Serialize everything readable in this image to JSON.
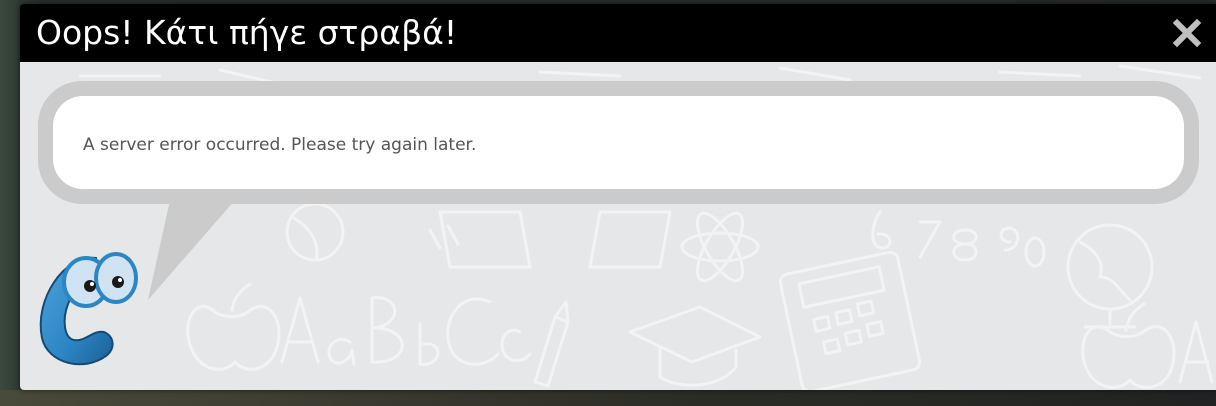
{
  "dialog": {
    "title": "Oops! Κάτι πήγε στραβά!",
    "close_icon": "close-icon",
    "message": "A server error occurred. Please try again later.",
    "mascot_icon": "mascot-icon"
  },
  "colors": {
    "header_bg": "#000000",
    "title_text": "#ffffff",
    "close_icon": "#bfbfbf",
    "body_bg": "#e6e7e8",
    "bubble_border": "#cbcbcb",
    "bubble_bg": "#ffffff",
    "message_text": "#555555",
    "mascot_blue": "#2b86c5"
  }
}
